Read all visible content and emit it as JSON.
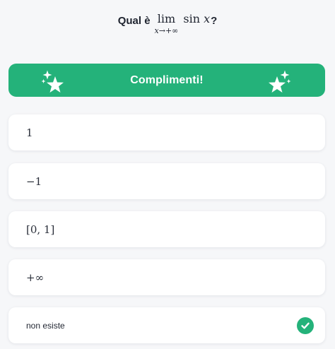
{
  "question": {
    "prefix": "Qual è",
    "lim_word": "lim",
    "lim_sub": "x→+∞",
    "function_name": "sin",
    "function_var": "x",
    "suffix": "?"
  },
  "feedback": {
    "text": "Complimenti!",
    "color": "#24b27a",
    "icon": "sparkle-stars-icon"
  },
  "options": [
    {
      "label": "1",
      "selected": false
    },
    {
      "label": "−1",
      "selected": false
    },
    {
      "label": "[0, 1]",
      "selected": false
    },
    {
      "label": "+∞",
      "selected": false
    },
    {
      "label": "non esiste",
      "selected": true
    }
  ],
  "correct_icon": "checkmark-circle-icon"
}
